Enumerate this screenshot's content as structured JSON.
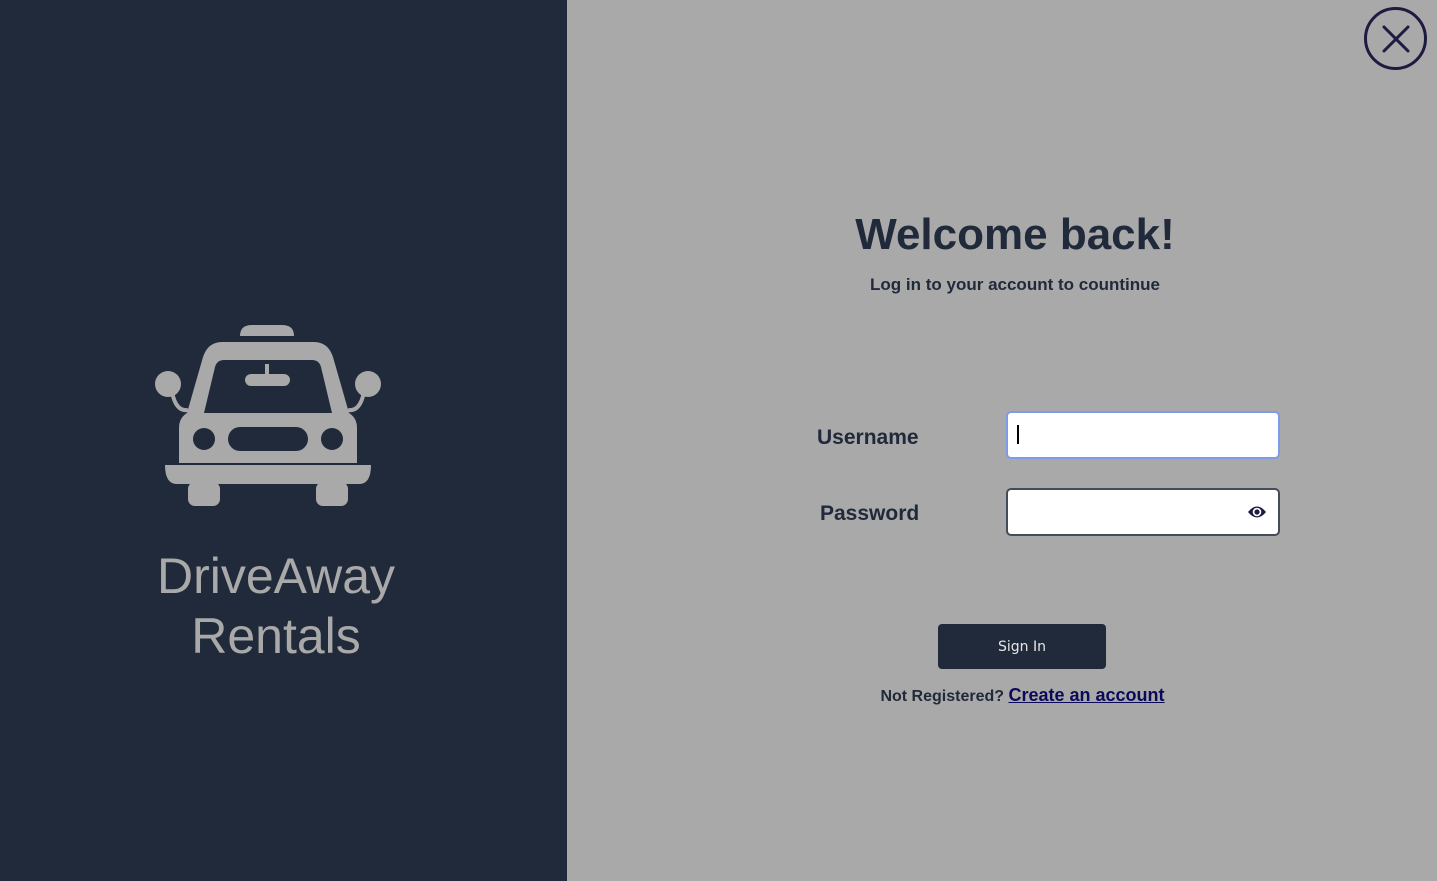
{
  "brand": {
    "line1": "DriveAway",
    "line2": "Rentals",
    "logo_icon": "taxi-car-icon"
  },
  "login": {
    "title": "Welcome back!",
    "subtitle": "Log in to your account to countinue",
    "username_label": "Username",
    "username_value": "",
    "password_label": "Password",
    "password_value": "",
    "sign_in_label": "Sign In",
    "not_registered_text": "Not Registered?",
    "create_account_link": "Create an account"
  },
  "icons": {
    "close": "close-icon",
    "password_toggle": "eye-icon"
  },
  "colors": {
    "left_panel_bg": "#212a3b",
    "right_panel_bg": "#a9a9a9",
    "button_bg": "#212a3b",
    "link": "#0b0a5a",
    "username_focus_border": "#7c9be8"
  }
}
